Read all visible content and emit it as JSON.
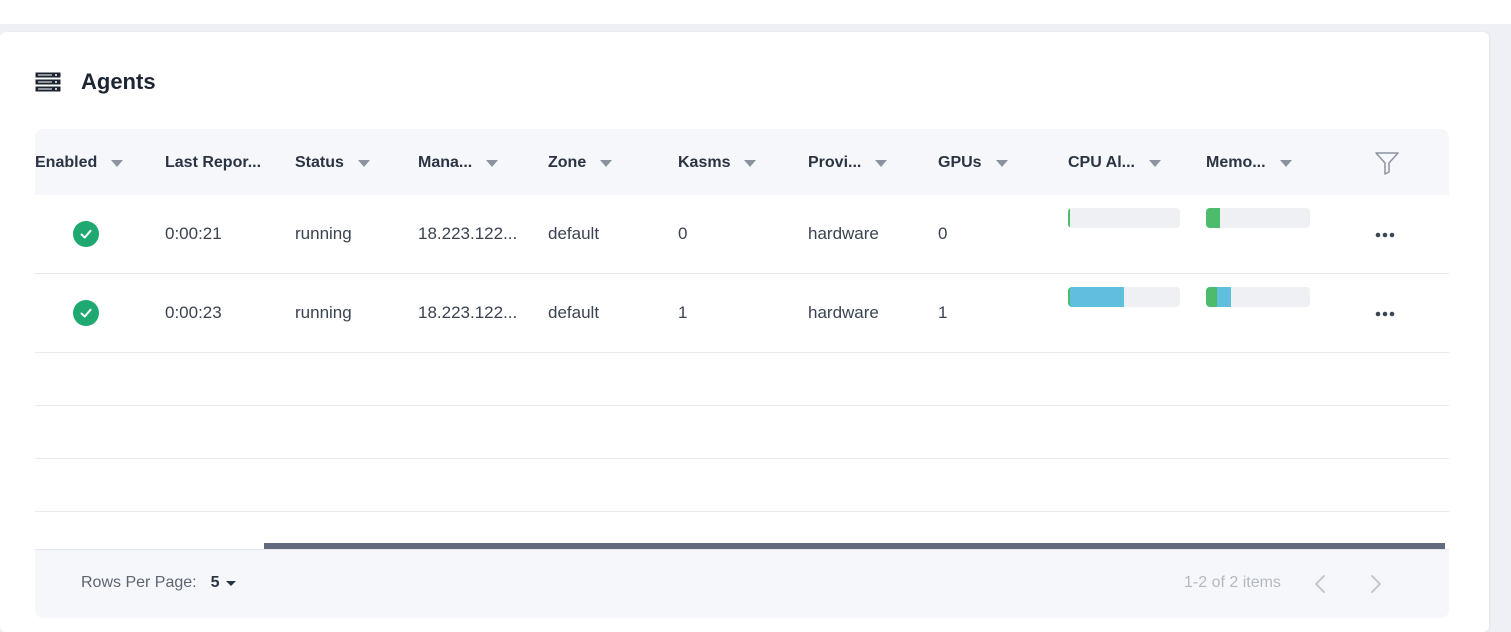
{
  "page": {
    "title": "Agents",
    "header_icon": "server-rack-icon"
  },
  "table": {
    "columns": [
      {
        "key": "enabled",
        "label": "Enabled"
      },
      {
        "key": "last_reported",
        "label": "Last Repor..."
      },
      {
        "key": "status",
        "label": "Status"
      },
      {
        "key": "manager",
        "label": "Mana..."
      },
      {
        "key": "zone",
        "label": "Zone"
      },
      {
        "key": "kasms",
        "label": "Kasms"
      },
      {
        "key": "provider",
        "label": "Provi..."
      },
      {
        "key": "gpus",
        "label": "GPUs"
      },
      {
        "key": "cpu",
        "label": "CPU Al..."
      },
      {
        "key": "memory",
        "label": "Memo..."
      }
    ],
    "rows": [
      {
        "enabled": true,
        "last_reported": "0:00:21",
        "status": "running",
        "manager": "18.223.122...",
        "zone": "default",
        "kasms": "0",
        "provider": "hardware",
        "gpus": "0",
        "cpu_allocation": {
          "used_fraction": 0.02,
          "reserved_fraction": 0.0
        },
        "memory_allocation": {
          "used_fraction": 0.13,
          "reserved_fraction": 0.0
        }
      },
      {
        "enabled": true,
        "last_reported": "0:00:23",
        "status": "running",
        "manager": "18.223.122...",
        "zone": "default",
        "kasms": "1",
        "provider": "hardware",
        "gpus": "1",
        "cpu_allocation": {
          "used_fraction": 0.02,
          "reserved_fraction": 0.48
        },
        "memory_allocation": {
          "used_fraction": 0.11,
          "reserved_fraction": 0.13
        }
      }
    ],
    "empty_rows": 3,
    "filter_icon": "filter-funnel-icon",
    "row_action_icon": "more-horizontal-icon"
  },
  "pagination": {
    "rows_per_page_label": "Rows Per Page:",
    "rows_per_page_value": "5",
    "items_text": "1-2 of 2 items",
    "prev_icon": "chevron-left-icon",
    "next_icon": "chevron-right-icon"
  },
  "colors": {
    "enabled_check": "#1fa971",
    "bar_used": "#4cbb6c",
    "bar_reserved": "#5fbfdc",
    "bar_track": "#eff0f3",
    "header_bg": "#f6f7fa",
    "scrollbar": "#626a7e"
  }
}
